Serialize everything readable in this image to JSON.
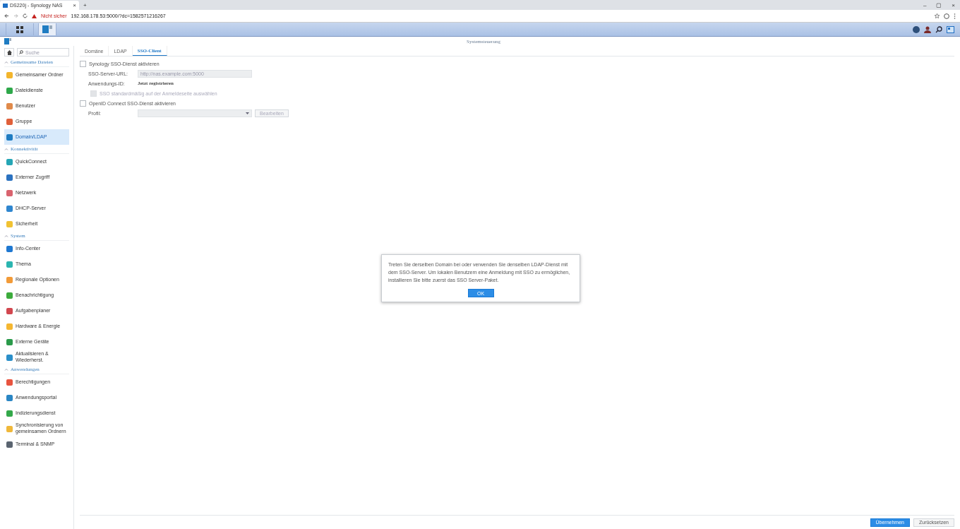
{
  "browser": {
    "tab": {
      "title": "DS220j - Synology NAS",
      "close": "×"
    },
    "new_tab": "+",
    "window_controls": [
      "–",
      "▢",
      "×"
    ],
    "security": "Nicht sicher",
    "url": "192.168.178.53:5000/?dc=1582571216267"
  },
  "taskbar": {
    "apps": [
      {
        "kind": "menu",
        "selected": false
      },
      {
        "kind": "app",
        "selected": true
      }
    ]
  },
  "window": {
    "title": "Systemsteuerung"
  },
  "sidebar": {
    "search": {
      "placeholder": "Suche"
    },
    "items": [
      {
        "kind": "section",
        "label": "Gemeinsame Dateien",
        "expanded": true
      },
      {
        "kind": "item",
        "label": "Gemeinsamer Ordner",
        "color": "#f3b52c",
        "selected": false
      },
      {
        "kind": "item",
        "label": "Dateidienste",
        "color": "#2ea84a",
        "selected": false
      },
      {
        "kind": "item",
        "label": "Benutzer",
        "color": "#e08a4a",
        "selected": false
      },
      {
        "kind": "item",
        "label": "Gruppe",
        "color": "#e0603a",
        "selected": false
      },
      {
        "kind": "item",
        "label": "Domain/LDAP",
        "color": "#1f7cc2",
        "selected": true
      },
      {
        "kind": "section",
        "label": "Konnektivität",
        "expanded": true
      },
      {
        "kind": "item",
        "label": "QuickConnect",
        "color": "#25a6b5",
        "selected": false
      },
      {
        "kind": "item",
        "label": "Externer Zugriff",
        "color": "#2b72c0",
        "selected": false
      },
      {
        "kind": "item",
        "label": "Netzwerk",
        "color": "#d9636e",
        "selected": false
      },
      {
        "kind": "item",
        "label": "DHCP-Server",
        "color": "#2f86cf",
        "selected": false
      },
      {
        "kind": "item",
        "label": "Sicherheit",
        "color": "#f1c232",
        "selected": false
      },
      {
        "kind": "section",
        "label": "System",
        "expanded": true
      },
      {
        "kind": "item",
        "label": "Info-Center",
        "color": "#1f78d1",
        "selected": false
      },
      {
        "kind": "item",
        "label": "Thema",
        "color": "#2bb5b0",
        "selected": false
      },
      {
        "kind": "item",
        "label": "Regionale Optionen",
        "color": "#f29b38",
        "selected": false
      },
      {
        "kind": "item",
        "label": "Benachrichtigung",
        "color": "#3cab3c",
        "selected": false
      },
      {
        "kind": "item",
        "label": "Aufgabenplaner",
        "color": "#d2474f",
        "selected": false
      },
      {
        "kind": "item",
        "label": "Hardware & Energie",
        "color": "#f5b731",
        "selected": false
      },
      {
        "kind": "item",
        "label": "Externe Geräte",
        "color": "#2a9a4a",
        "selected": false
      },
      {
        "kind": "item",
        "label": "Aktualisieren & Wiederherst.",
        "color": "#2b8fc9",
        "selected": false
      },
      {
        "kind": "section",
        "label": "Anwendungen",
        "expanded": true
      },
      {
        "kind": "item",
        "label": "Berechtigungen",
        "color": "#e8543f",
        "selected": false
      },
      {
        "kind": "item",
        "label": "Anwendungsportal",
        "color": "#2a86c4",
        "selected": false
      },
      {
        "kind": "item",
        "label": "Indizierungsdienst",
        "color": "#33a84a",
        "selected": false
      },
      {
        "kind": "item",
        "label": "Synchronisierung von gemeinsamen Ordnern",
        "color": "#f0b83a",
        "selected": false
      },
      {
        "kind": "item",
        "label": "Terminal & SNMP",
        "color": "#5a6470",
        "selected": false
      }
    ]
  },
  "tabs": [
    {
      "label": "Domäne",
      "selected": false
    },
    {
      "label": "LDAP",
      "selected": false
    },
    {
      "label": "SSO-Client",
      "selected": true
    }
  ],
  "form": [
    {
      "kind": "checkbox",
      "label": "Synology SSO-Dienst aktivieren",
      "checked": false,
      "disabled": false
    },
    {
      "kind": "field",
      "label": "SSO-Server-URL:",
      "placeholder": "http://nas.example.com:5000",
      "disabled": true
    },
    {
      "kind": "link",
      "label": "Anwendungs-ID:",
      "value": "Jetzt registrieren"
    },
    {
      "kind": "subcheckbox",
      "label": "SSO standardmäßig auf der Anmeldeseite auswählen",
      "checked": false,
      "disabled": true
    },
    {
      "kind": "checkbox",
      "label": "OpenID Connect SSO-Dienst aktivieren",
      "checked": false,
      "disabled": false
    },
    {
      "kind": "select",
      "label": "Profil:",
      "button": "Bearbeiten",
      "disabled": true
    }
  ],
  "footer": {
    "buttons": [
      {
        "label": "Übernehmen",
        "primary": true
      },
      {
        "label": "Zurücksetzen",
        "primary": false
      }
    ]
  },
  "dialog": {
    "message": "Treten Sie derselben Domain bei oder verwenden Sie denselben LDAP-Dienst mit dem SSO-Server. Um lokalen Benutzern eine Anmeldung mit SSO zu ermöglichen, installieren Sie bitte zuerst das SSO Server-Paket.",
    "button": "OK"
  }
}
